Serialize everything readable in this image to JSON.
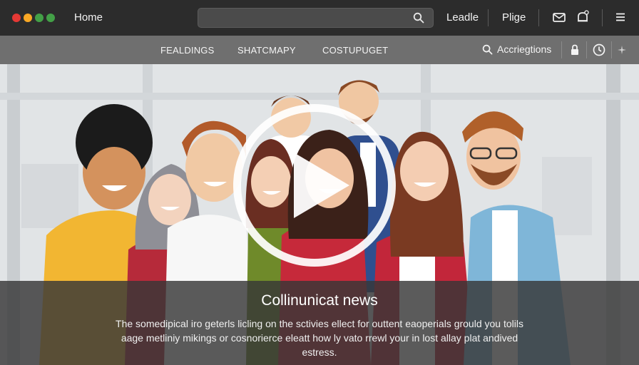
{
  "window": {
    "dot_colors": [
      "#e53935",
      "#f9a825",
      "#43a047",
      "#43a047"
    ]
  },
  "topbar": {
    "home_label": "Home",
    "search": {
      "placeholder": ""
    },
    "links": [
      "Leadle",
      "Plige"
    ],
    "icons": [
      "mail-icon",
      "notification-bell-icon",
      "menu-icon"
    ]
  },
  "nav": {
    "items": [
      "FEALDINGS",
      "SHATCMAPY",
      "COSTUPUGET"
    ],
    "accessibility_label": "Accriegtions",
    "icons": [
      "lock-icon",
      "clock-icon",
      "star-icon"
    ]
  },
  "hero": {
    "play_button": "play-icon",
    "title": "Collinunicat news",
    "body": "The somedipical iro geterls licling on the sctivies ellect for outtent eaoperials grould you tolils aage metliniy mikings or cosnorierce eleatt how ly vato rrewl your in lost allay plat andived estress."
  },
  "colors": {
    "topbar": "#2c2c2c",
    "navbar": "#6f6f6f",
    "caption": "#373737"
  }
}
